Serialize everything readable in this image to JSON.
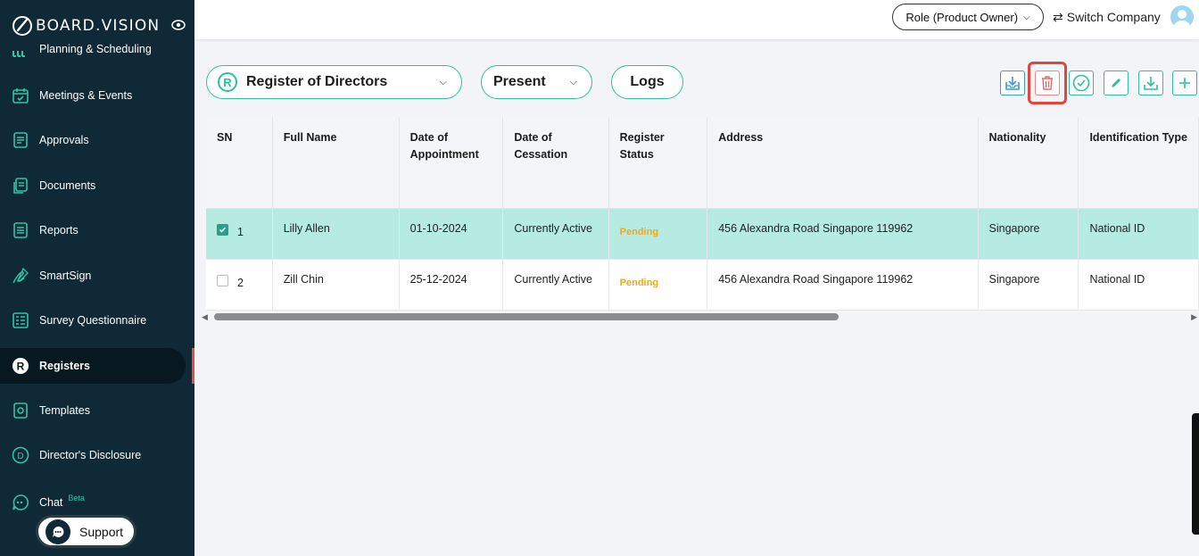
{
  "brand": {
    "name": "BOARD.VISION"
  },
  "sidebar": {
    "items": [
      {
        "label": "Planning & Scheduling",
        "icon": "calendar-grid-icon"
      },
      {
        "label": "Meetings & Events",
        "icon": "calendar-check-icon"
      },
      {
        "label": "Approvals",
        "icon": "approval-doc-icon"
      },
      {
        "label": "Documents",
        "icon": "documents-icon"
      },
      {
        "label": "Reports",
        "icon": "report-icon"
      },
      {
        "label": "SmartSign",
        "icon": "signature-icon"
      },
      {
        "label": "Survey Questionnaire",
        "icon": "survey-icon"
      },
      {
        "label": "Registers",
        "icon": "registers-icon"
      },
      {
        "label": "Templates",
        "icon": "templates-icon"
      },
      {
        "label": "Director's Disclosure",
        "icon": "disclosure-icon"
      },
      {
        "label": "Chat",
        "icon": "chat-icon",
        "badge": "Beta"
      }
    ],
    "support_label": "Support"
  },
  "header": {
    "role_label": "Role (Product Owner)",
    "switch_company_label": "Switch Company"
  },
  "filters": {
    "register_label": "Register of Directors",
    "register_badge": "R",
    "period_label": "Present",
    "logs_label": "Logs"
  },
  "toolbar": {
    "buttons": [
      "import-icon",
      "trash-icon",
      "check-circle-icon",
      "pencil-icon",
      "download-icon",
      "plus-icon"
    ]
  },
  "table": {
    "columns": [
      "SN",
      "Full Name",
      "Date of Appointment",
      "Date of Cessation",
      "Register Status",
      "Address",
      "Nationality",
      "Identification Type"
    ],
    "rows": [
      {
        "sn": "1",
        "name": "Lilly Allen",
        "appointment": "01-10-2024",
        "cessation": "Currently Active",
        "status": "Pending",
        "address": "456 Alexandra Road Singapore 119962",
        "nationality": "Singapore",
        "id_type": "National ID",
        "checked": true
      },
      {
        "sn": "2",
        "name": "Zill Chin",
        "appointment": "25-12-2024",
        "cessation": "Currently Active",
        "status": "Pending",
        "address": "456 Alexandra Road Singapore 119962",
        "nationality": "Singapore",
        "id_type": "National ID",
        "checked": false
      }
    ]
  },
  "colors": {
    "sidebar_bg": "#0f2a36",
    "accent": "#2fbfa0",
    "selected_row": "#b6ebe2",
    "pending": "#f0a81e",
    "highlight": "#e0463d"
  }
}
